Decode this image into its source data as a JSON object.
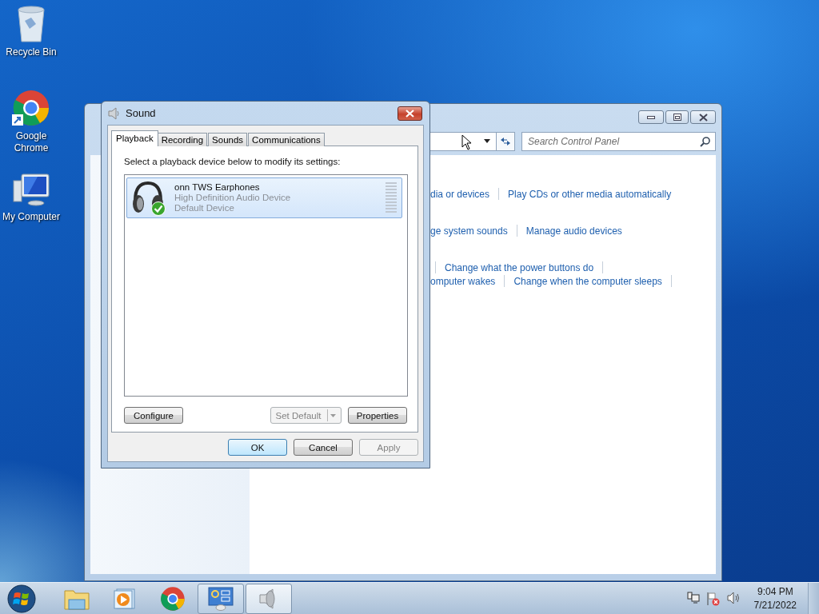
{
  "desktop_icons": [
    {
      "label": "Recycle Bin",
      "kind": "recycle"
    },
    {
      "label": "Google Chrome",
      "kind": "chrome"
    },
    {
      "label": "My Computer",
      "kind": "computer"
    }
  ],
  "control_panel": {
    "search": {
      "placeholder": "Search Control Panel"
    },
    "sections": [
      {
        "rows": [
          [
            {
              "kind": "link",
              "text": "dia or devices"
            },
            {
              "kind": "divider"
            },
            {
              "kind": "link",
              "text": "Play CDs or other media automatically"
            }
          ]
        ]
      },
      {
        "rows": [
          [
            {
              "kind": "link",
              "text": "ge system sounds"
            },
            {
              "kind": "divider"
            },
            {
              "kind": "link",
              "text": "Manage audio devices"
            }
          ]
        ]
      },
      {
        "rows": [
          [
            {
              "kind": "divider"
            },
            {
              "kind": "link",
              "text": "Change what the power buttons do"
            },
            {
              "kind": "divider"
            }
          ],
          [
            {
              "kind": "link",
              "text": "omputer wakes"
            },
            {
              "kind": "divider"
            },
            {
              "kind": "link",
              "text": "Change when the computer sleeps"
            },
            {
              "kind": "divider"
            }
          ]
        ]
      }
    ]
  },
  "sound_dialog": {
    "title": "Sound",
    "tabs": [
      {
        "label": "Playback",
        "selected": true
      },
      {
        "label": "Recording",
        "selected": false
      },
      {
        "label": "Sounds",
        "selected": false
      },
      {
        "label": "Communications",
        "selected": false
      }
    ],
    "instruction": "Select a playback device below to modify its settings:",
    "devices": [
      {
        "name": "onn TWS Earphones",
        "description": "High Definition Audio Device",
        "status": "Default Device",
        "selected": true,
        "is_default": true,
        "level": 0
      }
    ],
    "device_buttons": [
      {
        "label": "Configure",
        "kind": "plain",
        "disabled": false
      },
      {
        "label": "Set Default",
        "kind": "split",
        "disabled": true
      },
      {
        "label": "Properties",
        "kind": "plain",
        "disabled": false
      }
    ],
    "footer_buttons": [
      {
        "label": "OK",
        "default": true,
        "disabled": false
      },
      {
        "label": "Cancel",
        "default": false,
        "disabled": false
      },
      {
        "label": "Apply",
        "default": false,
        "disabled": true
      }
    ]
  },
  "taskbar": {
    "apps": [
      {
        "kind": "explorer",
        "open": false,
        "active": false
      },
      {
        "kind": "media",
        "open": false,
        "active": false
      },
      {
        "kind": "chrome",
        "open": false,
        "active": false
      },
      {
        "kind": "control",
        "open": true,
        "active": false
      },
      {
        "kind": "sound",
        "open": true,
        "active": true
      }
    ],
    "tray": [
      {
        "kind": "network"
      },
      {
        "kind": "flag"
      },
      {
        "kind": "volume"
      }
    ],
    "time": "9:04 PM",
    "date": "7/21/2022"
  }
}
